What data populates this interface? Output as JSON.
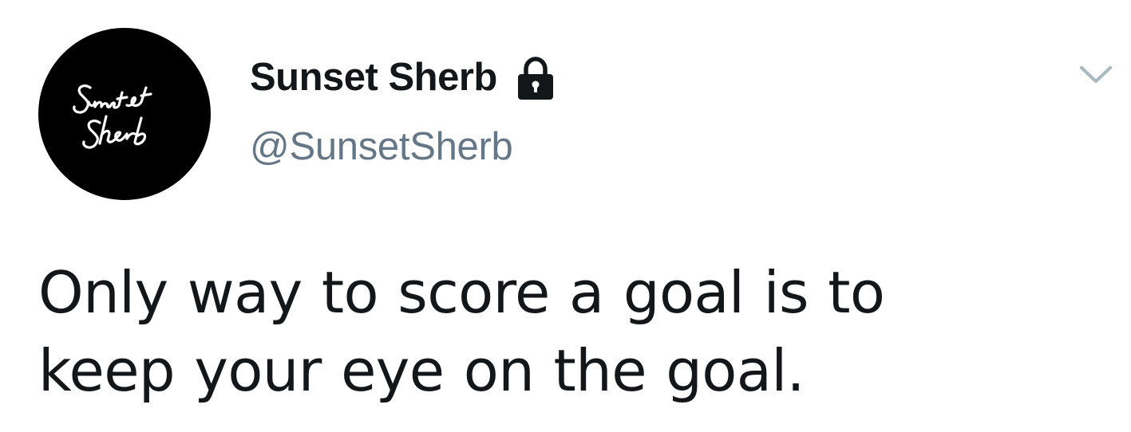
{
  "author": {
    "display_name": "Sunset Sherb",
    "handle": "@SunsetSherb",
    "protected": true,
    "avatar_logo_text": "Sunset Sherb"
  },
  "tweet": {
    "text_lines": [
      "Only way to score a goal is to",
      "keep your eye on the goal."
    ]
  },
  "icons": {
    "lock": "lock-icon",
    "menu": "chevron-down-icon"
  },
  "colors": {
    "text": "#14171a",
    "handle": "#657786",
    "caret": "#aab8c2",
    "avatar_bg": "#000000"
  }
}
